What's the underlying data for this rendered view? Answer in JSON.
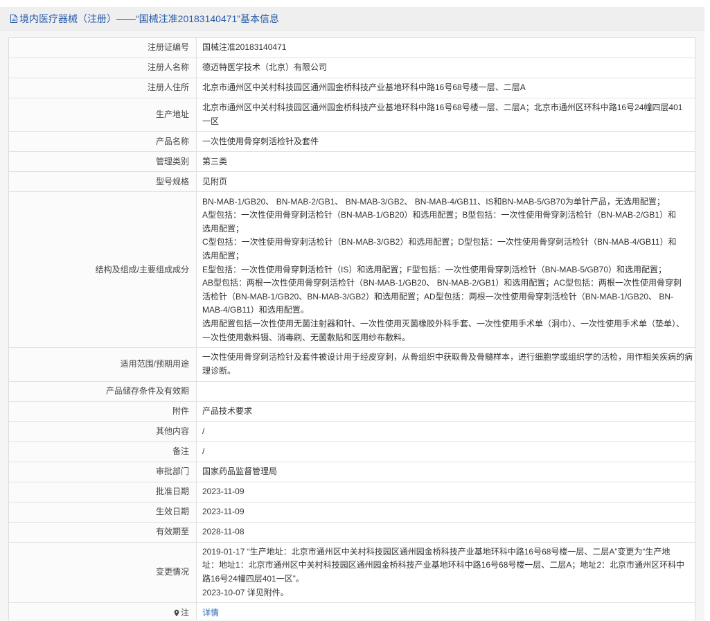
{
  "theme": {
    "title_color": "#2a5ca8",
    "link_color": "#2d6cc0",
    "label_color": "#444444",
    "text_color": "#333333",
    "border_color": "#e1e1e1"
  },
  "header": {
    "icon": "document-icon",
    "title": "境内医疗器械（注册）——“国械注准20183140471”基本信息"
  },
  "rows": [
    {
      "label": "注册证编号",
      "value": "国械注准20183140471"
    },
    {
      "label": "注册人名称",
      "value": "德迈特医学技术（北京）有限公司"
    },
    {
      "label": "注册人住所",
      "value": "北京市通州区中关村科技园区通州园金桥科技产业基地环科中路16号68号楼一层、二层A"
    },
    {
      "label": "生产地址",
      "lines": [
        "北京市通州区中关村科技园区通州园金桥科技产业基地环科中路16号68号楼一层、二层A；北京市通州区环科中路16号24幢四层401",
        "一区"
      ]
    },
    {
      "label": "产品名称",
      "value": "一次性使用骨穿刺活检针及套件"
    },
    {
      "label": "管理类别",
      "value": "第三类"
    },
    {
      "label": "型号规格",
      "value": "见附页"
    },
    {
      "label": "结构及组成/主要组成成分",
      "lines": [
        "BN-MAB-1/GB20、 BN-MAB-2/GB1、 BN-MAB-3/GB2、 BN-MAB-4/GB11、IS和BN-MAB-5/GB70为单针产品，无选用配置；",
        "A型包括：一次性使用骨穿刺活检针（BN-MAB-1/GB20）和选用配置；B型包括：一次性使用骨穿刺活检针（BN-MAB-2/GB1）和",
        "选用配置；",
        "C型包括：一次性使用骨穿刺活检针（BN-MAB-3/GB2）和选用配置；D型包括：一次性使用骨穿刺活检针（BN-MAB-4/GB11）和",
        "选用配置；",
        "E型包括：一次性使用骨穿刺活检针（IS）和选用配置；F型包括：一次性使用骨穿刺活检针（BN-MAB-5/GB70）和选用配置；",
        "AB型包括：两根一次性使用骨穿刺活检针（BN-MAB-1/GB20、 BN-MAB-2/GB1）和选用配置；AC型包括：两根一次性使用骨穿刺",
        "活检针（BN-MAB-1/GB20、BN-MAB-3/GB2）和选用配置；AD型包括：两根一次性使用骨穿刺活检针（BN-MAB-1/GB20、 BN-",
        "MAB-4/GB11）和选用配置。",
        "选用配置包括一次性使用无菌注射器和针、一次性使用灭菌橡胶外科手套、一次性使用手术单（洞巾）、一次性使用手术单（垫单）、",
        "一次性使用敷料镊、消毒刷、无菌敷贴和医用纱布敷料。"
      ]
    },
    {
      "label": "适用范围/预期用途",
      "lines": [
        "一次性使用骨穿刺活检针及套件被设计用于经皮穿刺，从骨组织中获取骨及骨髓样本，进行细胞学或组织学的活检，用作相关疾病的病",
        "理诊断。"
      ]
    },
    {
      "label": "产品储存条件及有效期"
    },
    {
      "label": "附件",
      "value": "产品技术要求"
    },
    {
      "label": "其他内容",
      "value": "/"
    },
    {
      "label": "备注",
      "value": "/"
    },
    {
      "label": "审批部门",
      "value": "国家药品监督管理局"
    },
    {
      "label": "批准日期",
      "value": "2023-11-09"
    },
    {
      "label": "生效日期",
      "value": "2023-11-09"
    },
    {
      "label": "有效期至",
      "value": "2028-11-08"
    },
    {
      "label": "变更情况",
      "lines": [
        "2019-01-17 “生产地址：北京市通州区中关村科技园区通州园金桥科技产业基地环科中路16号68号楼一层、二层A”变更为“生产地",
        "址：地址1：北京市通州区中关村科技园区通州园金桥科技产业基地环科中路16号68号楼一层、二层A；地址2：北京市通州区环科中",
        "路16号24幢四层401一区”。",
        "2023-10-07 详见附件。"
      ]
    },
    {
      "label": "注",
      "icon": "pin-icon",
      "link": "详情"
    }
  ]
}
